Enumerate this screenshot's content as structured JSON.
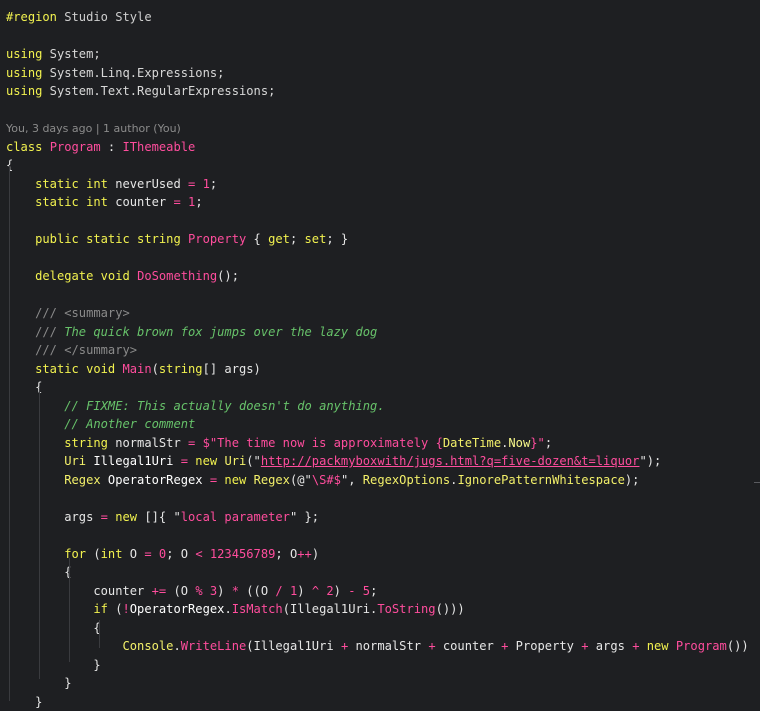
{
  "editor": {
    "lines": [
      [
        {
          "t": "#region",
          "c": "preproc"
        },
        {
          "t": " Studio Style",
          "c": "preproc-text"
        }
      ],
      [],
      [
        {
          "t": "using",
          "c": "keyword"
        },
        {
          "t": " System;",
          "c": "ns"
        }
      ],
      [
        {
          "t": "using",
          "c": "keyword"
        },
        {
          "t": " System.Linq.Expressions;",
          "c": "ns"
        }
      ],
      [
        {
          "t": "using",
          "c": "keyword"
        },
        {
          "t": " System.Text.RegularExpressions;",
          "c": "ns"
        }
      ],
      [],
      [
        {
          "t": "You, 3 days ago | 1 author (You)",
          "c": "meta"
        }
      ],
      [
        {
          "t": "class",
          "c": "keyword"
        },
        {
          "t": " ",
          "c": "default"
        },
        {
          "t": "Program",
          "c": "class"
        },
        {
          "t": " : ",
          "c": "default"
        },
        {
          "t": "IThemeable",
          "c": "class"
        }
      ],
      [
        {
          "t": "{",
          "c": "default"
        }
      ],
      [
        {
          "t": "    static",
          "c": "keyword"
        },
        {
          "t": " int",
          "c": "keyword"
        },
        {
          "t": " neverUsed ",
          "c": "default"
        },
        {
          "t": "=",
          "c": "op"
        },
        {
          "t": " ",
          "c": "default"
        },
        {
          "t": "1",
          "c": "number"
        },
        {
          "t": ";",
          "c": "default"
        }
      ],
      [
        {
          "t": "    static",
          "c": "keyword"
        },
        {
          "t": " int",
          "c": "keyword"
        },
        {
          "t": " counter ",
          "c": "default"
        },
        {
          "t": "=",
          "c": "op"
        },
        {
          "t": " ",
          "c": "default"
        },
        {
          "t": "1",
          "c": "number"
        },
        {
          "t": ";",
          "c": "default"
        }
      ],
      [],
      [
        {
          "t": "    public",
          "c": "keyword"
        },
        {
          "t": " static",
          "c": "keyword"
        },
        {
          "t": " string",
          "c": "keyword"
        },
        {
          "t": " ",
          "c": "default"
        },
        {
          "t": "Property",
          "c": "prop"
        },
        {
          "t": " { ",
          "c": "default"
        },
        {
          "t": "get",
          "c": "keyword"
        },
        {
          "t": "; ",
          "c": "default"
        },
        {
          "t": "set",
          "c": "keyword"
        },
        {
          "t": "; }",
          "c": "default"
        }
      ],
      [],
      [
        {
          "t": "    delegate",
          "c": "keyword"
        },
        {
          "t": " void",
          "c": "keyword"
        },
        {
          "t": " ",
          "c": "default"
        },
        {
          "t": "DoSomething",
          "c": "method"
        },
        {
          "t": "();",
          "c": "default"
        }
      ],
      [],
      [
        {
          "t": "    /// <summary>",
          "c": "doc-tag"
        }
      ],
      [
        {
          "t": "    /// ",
          "c": "doc-tag"
        },
        {
          "t": "The quick brown fox jumps over the lazy dog",
          "c": "comment"
        }
      ],
      [
        {
          "t": "    /// </summary>",
          "c": "doc-tag"
        }
      ],
      [
        {
          "t": "    static",
          "c": "keyword"
        },
        {
          "t": " void",
          "c": "keyword"
        },
        {
          "t": " ",
          "c": "default"
        },
        {
          "t": "Main",
          "c": "method"
        },
        {
          "t": "(",
          "c": "default"
        },
        {
          "t": "string",
          "c": "keyword"
        },
        {
          "t": "[] args)",
          "c": "default"
        }
      ],
      [
        {
          "t": "    {",
          "c": "default"
        }
      ],
      [
        {
          "t": "        // FIXME: This actually doesn't do anything.",
          "c": "comment"
        }
      ],
      [
        {
          "t": "        // Another comment",
          "c": "comment"
        }
      ],
      [
        {
          "t": "        string",
          "c": "keyword"
        },
        {
          "t": " normalStr ",
          "c": "default"
        },
        {
          "t": "=",
          "c": "op"
        },
        {
          "t": " ",
          "c": "default"
        },
        {
          "t": "$\"The time now is approximately ",
          "c": "string"
        },
        {
          "t": "{",
          "c": "string"
        },
        {
          "t": "DateTime",
          "c": "type"
        },
        {
          "t": ".",
          "c": "default"
        },
        {
          "t": "Now",
          "c": "interp"
        },
        {
          "t": "}\"",
          "c": "string"
        },
        {
          "t": ";",
          "c": "default"
        }
      ],
      [
        {
          "t": "        Uri",
          "c": "type"
        },
        {
          "t": " Illegal1Uri ",
          "c": "white"
        },
        {
          "t": "=",
          "c": "op"
        },
        {
          "t": " new",
          "c": "keyword"
        },
        {
          "t": " ",
          "c": "default"
        },
        {
          "t": "Uri",
          "c": "type"
        },
        {
          "t": "(\"",
          "c": "default"
        },
        {
          "t": "http://packmyboxwith/jugs.html?q=five-dozen&t=liquor",
          "c": "url"
        },
        {
          "t": "\");",
          "c": "default"
        }
      ],
      [
        {
          "t": "        Regex",
          "c": "type"
        },
        {
          "t": " OperatorRegex ",
          "c": "white"
        },
        {
          "t": "=",
          "c": "op"
        },
        {
          "t": " new",
          "c": "keyword"
        },
        {
          "t": " ",
          "c": "default"
        },
        {
          "t": "Regex",
          "c": "type"
        },
        {
          "t": "(@\"",
          "c": "default"
        },
        {
          "t": "\\S#$",
          "c": "string"
        },
        {
          "t": "\", ",
          "c": "default"
        },
        {
          "t": "RegexOptions",
          "c": "type"
        },
        {
          "t": ".",
          "c": "default"
        },
        {
          "t": "IgnorePatternWhitespace",
          "c": "type"
        },
        {
          "t": ");",
          "c": "default"
        }
      ],
      [],
      [
        {
          "t": "        args ",
          "c": "default"
        },
        {
          "t": "=",
          "c": "op"
        },
        {
          "t": " new",
          "c": "keyword"
        },
        {
          "t": " []{ \"",
          "c": "default"
        },
        {
          "t": "local parameter",
          "c": "string"
        },
        {
          "t": "\" };",
          "c": "default"
        }
      ],
      [],
      [
        {
          "t": "        for",
          "c": "keyword"
        },
        {
          "t": " (",
          "c": "default"
        },
        {
          "t": "int",
          "c": "keyword"
        },
        {
          "t": " O ",
          "c": "default"
        },
        {
          "t": "=",
          "c": "op"
        },
        {
          "t": " ",
          "c": "default"
        },
        {
          "t": "0",
          "c": "number"
        },
        {
          "t": "; O ",
          "c": "default"
        },
        {
          "t": "<",
          "c": "op"
        },
        {
          "t": " ",
          "c": "default"
        },
        {
          "t": "123456789",
          "c": "number"
        },
        {
          "t": "; O",
          "c": "default"
        },
        {
          "t": "++",
          "c": "op"
        },
        {
          "t": ")",
          "c": "default"
        }
      ],
      [
        {
          "t": "        {",
          "c": "default"
        }
      ],
      [
        {
          "t": "            counter ",
          "c": "default"
        },
        {
          "t": "+=",
          "c": "op"
        },
        {
          "t": " (O ",
          "c": "default"
        },
        {
          "t": "%",
          "c": "op"
        },
        {
          "t": " ",
          "c": "default"
        },
        {
          "t": "3",
          "c": "number"
        },
        {
          "t": ") ",
          "c": "default"
        },
        {
          "t": "*",
          "c": "op"
        },
        {
          "t": " ((O ",
          "c": "default"
        },
        {
          "t": "/",
          "c": "op"
        },
        {
          "t": " ",
          "c": "default"
        },
        {
          "t": "1",
          "c": "number"
        },
        {
          "t": ") ",
          "c": "default"
        },
        {
          "t": "^",
          "c": "op"
        },
        {
          "t": " ",
          "c": "default"
        },
        {
          "t": "2",
          "c": "number"
        },
        {
          "t": ") ",
          "c": "default"
        },
        {
          "t": "-",
          "c": "op"
        },
        {
          "t": " ",
          "c": "default"
        },
        {
          "t": "5",
          "c": "number"
        },
        {
          "t": ";",
          "c": "default"
        }
      ],
      [
        {
          "t": "            if",
          "c": "keyword"
        },
        {
          "t": " (",
          "c": "default"
        },
        {
          "t": "!",
          "c": "op"
        },
        {
          "t": "OperatorRegex",
          "c": "white"
        },
        {
          "t": ".",
          "c": "default"
        },
        {
          "t": "IsMatch",
          "c": "method"
        },
        {
          "t": "(Illegal1Uri.",
          "c": "default"
        },
        {
          "t": "ToString",
          "c": "method"
        },
        {
          "t": "()))",
          "c": "default"
        }
      ],
      [
        {
          "t": "            {",
          "c": "default"
        }
      ],
      [
        {
          "t": "                Console",
          "c": "type"
        },
        {
          "t": ".",
          "c": "default"
        },
        {
          "t": "WriteLine",
          "c": "method"
        },
        {
          "t": "(Illegal1Uri ",
          "c": "default"
        },
        {
          "t": "+",
          "c": "op"
        },
        {
          "t": " normalStr ",
          "c": "default"
        },
        {
          "t": "+",
          "c": "op"
        },
        {
          "t": " counter ",
          "c": "default"
        },
        {
          "t": "+",
          "c": "op"
        },
        {
          "t": " Property ",
          "c": "default"
        },
        {
          "t": "+",
          "c": "op"
        },
        {
          "t": " args ",
          "c": "default"
        },
        {
          "t": "+",
          "c": "op"
        },
        {
          "t": " new",
          "c": "keyword"
        },
        {
          "t": " ",
          "c": "default"
        },
        {
          "t": "Program",
          "c": "class"
        },
        {
          "t": "())",
          "c": "default"
        }
      ],
      [
        {
          "t": "            }",
          "c": "default"
        }
      ],
      [
        {
          "t": "        }",
          "c": "default"
        }
      ],
      [
        {
          "t": "    }",
          "c": "default"
        }
      ]
    ]
  }
}
